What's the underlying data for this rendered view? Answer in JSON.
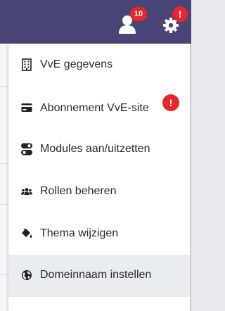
{
  "header": {
    "user_badge": "10",
    "settings_badge": "!"
  },
  "menu": {
    "items": [
      {
        "label": "VvE gegevens",
        "icon": "building-icon"
      },
      {
        "label": "Abonnement VvE-site",
        "icon": "credit-card-icon",
        "badge": "!"
      },
      {
        "label": "Modules aan/uitzetten",
        "icon": "toggle-icon"
      },
      {
        "label": "Rollen beheren",
        "icon": "users-icon"
      },
      {
        "label": "Thema wijzigen",
        "icon": "paint-bucket-icon"
      },
      {
        "label": "Domeinnaam instellen",
        "icon": "globe-icon"
      }
    ]
  },
  "colors": {
    "header_bg": "#4a4577",
    "badge": "#e8262b",
    "active_item_bg": "#e9ecf0"
  }
}
